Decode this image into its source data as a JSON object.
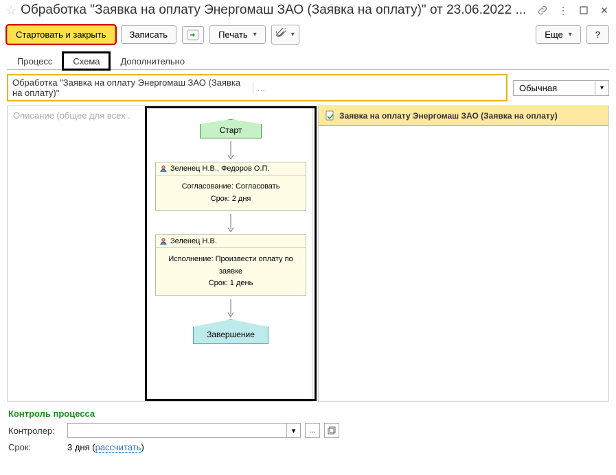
{
  "header": {
    "title": "Обработка \"Заявка на оплату Энергомаш ЗАО (Заявка на оплату)\" от 23.06.2022 ..."
  },
  "toolbar": {
    "start_and_close": "Стартовать и закрыть",
    "write": "Записать",
    "print": "Печать",
    "more": "Еще",
    "help": "?"
  },
  "tabs": {
    "process": "Процесс",
    "scheme": "Схема",
    "additional": "Дополнительно"
  },
  "subject": {
    "value": "Обработка \"Заявка на оплату Энергомаш ЗАО (Заявка на оплату)\""
  },
  "priority": {
    "selected": "Обычная"
  },
  "description_placeholder": "Описание (общее для всех .",
  "schema": {
    "start": "Старт",
    "tasks": [
      {
        "assignees": "Зеленец Н.В., Федоров О.П.",
        "line1": "Согласование: Согласовать",
        "line2": "Срок: 2 дня"
      },
      {
        "assignees": "Зеленец Н.В.",
        "line1": "Исполнение: Произвести оплату по заявке",
        "line2": "Срок: 1 день"
      }
    ],
    "end": "Завершение"
  },
  "right": {
    "doc_title": "Заявка на оплату Энергомаш ЗАО (Заявка на оплату)"
  },
  "control": {
    "section_title": "Контроль процесса",
    "controller_label": "Контролер:",
    "deadline_label": "Срок:",
    "deadline_value": "3 дня",
    "calc_link": "рассчитать"
  }
}
